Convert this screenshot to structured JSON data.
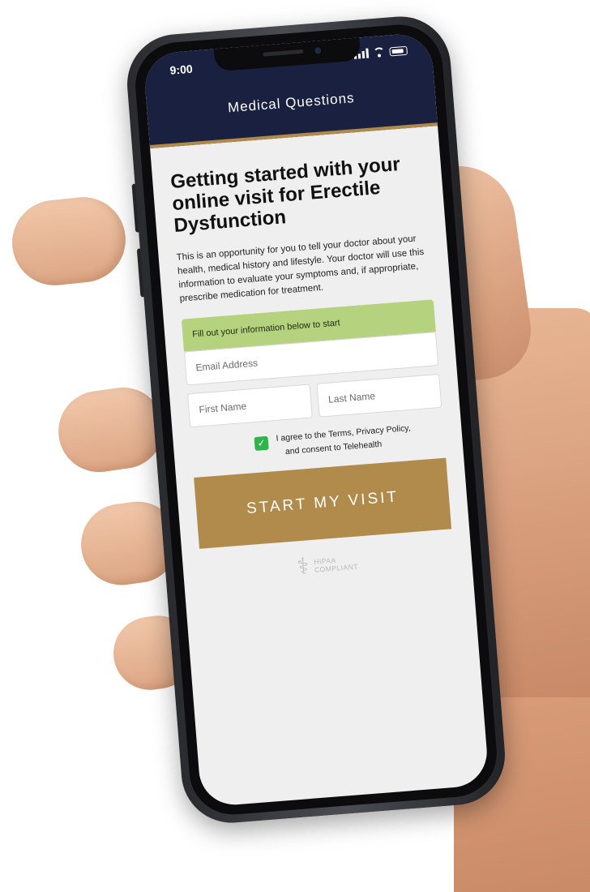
{
  "status_bar": {
    "time": "9:00"
  },
  "header": {
    "title": "Medical Questions"
  },
  "main": {
    "headline": "Getting started with your online visit for Erectile Dysfunction",
    "intro": "This is an opportunity for you to tell your doctor about your health, medical history and lifestyle. Your doctor will use this information to evaluate your symptoms and, if appropriate, prescribe medication for treatment.",
    "notice": "Fill out your information below to start"
  },
  "form": {
    "email_placeholder": "Email Address",
    "first_name_placeholder": "First Name",
    "last_name_placeholder": "Last Name",
    "agree_line1": "I agree to the Terms, Privacy Policy,",
    "agree_line2": "and consent to Telehealth",
    "agree_checked": true,
    "submit_label": "START MY VISIT"
  },
  "badge": {
    "line1": "HIPAA",
    "line2": "COMPLIANT",
    "icon": "caduceus-icon"
  },
  "colors": {
    "header_bg": "#1a2140",
    "accent_gold": "#b08b4b",
    "notice_green": "#b5d27f",
    "checkbox_green": "#2fb34a"
  }
}
